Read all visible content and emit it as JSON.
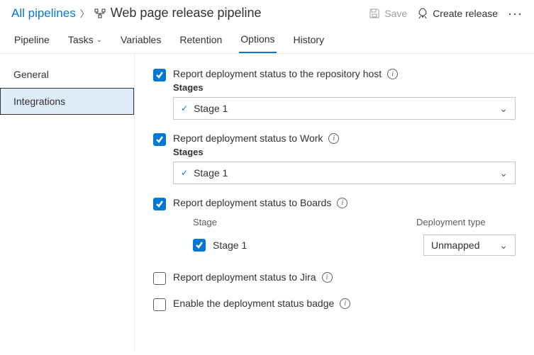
{
  "breadcrumb": {
    "root": "All pipelines",
    "title": "Web page release pipeline"
  },
  "actions": {
    "save": "Save",
    "create_release": "Create release"
  },
  "tabs": {
    "pipeline": "Pipeline",
    "tasks": "Tasks",
    "variables": "Variables",
    "retention": "Retention",
    "options": "Options",
    "history": "History"
  },
  "sidebar": {
    "general": "General",
    "integrations": "Integrations"
  },
  "options": {
    "repo_host": {
      "label": "Report deployment status to the repository host",
      "stages_label": "Stages",
      "selected": "Stage 1"
    },
    "work": {
      "label": "Report deployment status to Work",
      "stages_label": "Stages",
      "selected": "Stage 1"
    },
    "boards": {
      "label": "Report deployment status to Boards",
      "col_stage": "Stage",
      "col_dep": "Deployment type",
      "row_stage": "Stage 1",
      "row_dep": "Unmapped"
    },
    "jira": {
      "label": "Report deployment status to Jira"
    },
    "badge": {
      "label": "Enable the deployment status badge"
    }
  }
}
